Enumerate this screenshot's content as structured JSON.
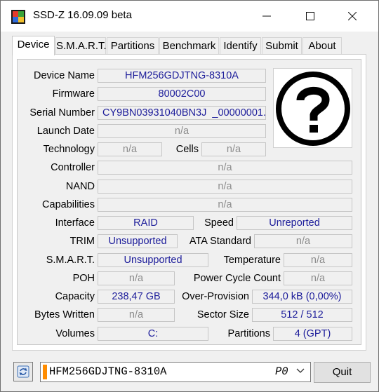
{
  "window": {
    "title": "SSD-Z 16.09.09 beta",
    "icon": "ssdz-app-icon"
  },
  "tabs": [
    "Device",
    "S.M.A.R.T.",
    "Partitions",
    "Benchmark",
    "Identify",
    "Submit",
    "About"
  ],
  "active_tab": "Device",
  "device": {
    "device_name": {
      "label": "Device Name",
      "value": "HFM256GDJTNG-8310A"
    },
    "firmware": {
      "label": "Firmware",
      "value": "80002C00"
    },
    "serial_number": {
      "label": "Serial Number",
      "value": "CY9BN03931040BN3J  _00000001."
    },
    "launch_date": {
      "label": "Launch Date",
      "value": "n/a"
    },
    "technology": {
      "label": "Technology",
      "value": "n/a"
    },
    "cells": {
      "label": "Cells",
      "value": "n/a"
    },
    "controller": {
      "label": "Controller",
      "value": "n/a"
    },
    "nand": {
      "label": "NAND",
      "value": "n/a"
    },
    "capabilities": {
      "label": "Capabilities",
      "value": "n/a"
    },
    "interface": {
      "label": "Interface",
      "value": "RAID"
    },
    "speed": {
      "label": "Speed",
      "value": "Unreported"
    },
    "trim": {
      "label": "TRIM",
      "value": "Unsupported"
    },
    "ata_standard": {
      "label": "ATA Standard",
      "value": "n/a"
    },
    "smart": {
      "label": "S.M.A.R.T.",
      "value": "Unsupported"
    },
    "temperature": {
      "label": "Temperature",
      "value": "n/a"
    },
    "poh": {
      "label": "POH",
      "value": "n/a"
    },
    "power_cycle_count": {
      "label": "Power Cycle Count",
      "value": "n/a"
    },
    "capacity": {
      "label": "Capacity",
      "value": "238,47 GB"
    },
    "over_provision": {
      "label": "Over-Provision",
      "value": "344,0 kB (0,00%)"
    },
    "bytes_written": {
      "label": "Bytes Written",
      "value": "n/a"
    },
    "sector_size": {
      "label": "Sector Size",
      "value": "512 / 512"
    },
    "volumes": {
      "label": "Volumes",
      "value": "C:"
    },
    "partitions": {
      "label": "Partitions",
      "value": "4 (GPT)"
    }
  },
  "vendor_logo": "unknown-vendor-question-icon",
  "bottom": {
    "refresh_icon": "refresh-icon",
    "drive_selected": "HFM256GDJTNG-8310A",
    "drive_port": "P0",
    "quit_label": "Quit"
  },
  "colors": {
    "value_text": "#1c1c9a",
    "na_text": "#8c8c8c",
    "drive_accent": "#ff8c00"
  }
}
